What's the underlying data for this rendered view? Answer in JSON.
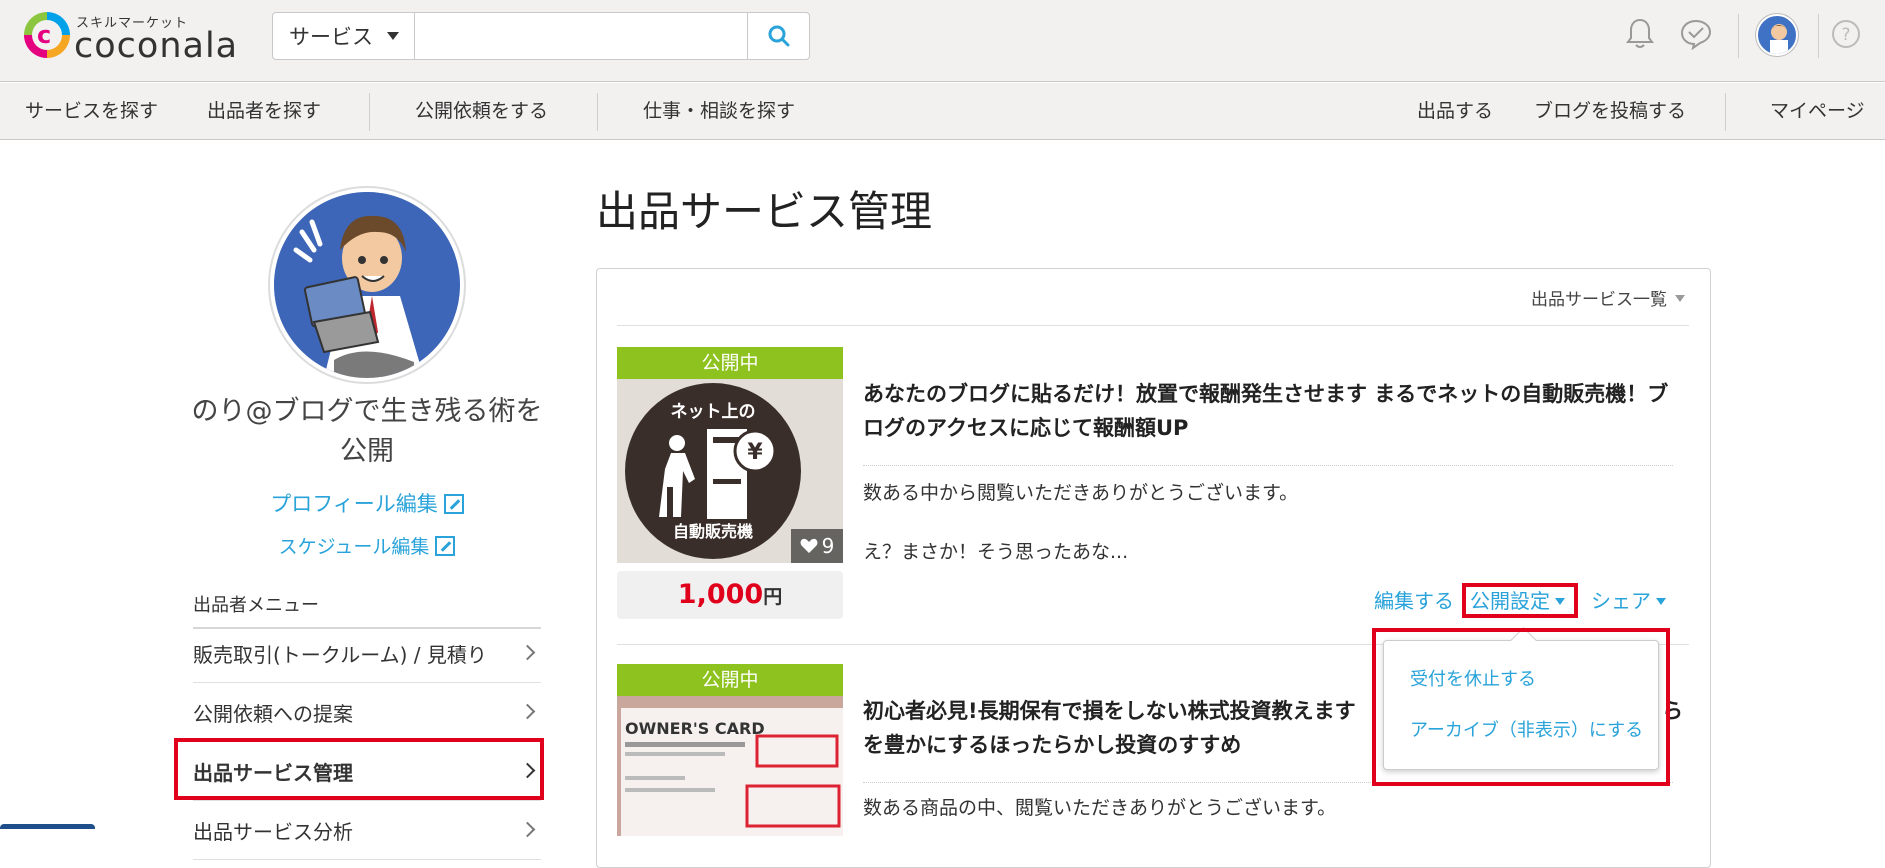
{
  "header": {
    "logo_small": "スキルマーケット",
    "logo_text": "coconala",
    "search": {
      "category": "サービス",
      "placeholder": ""
    }
  },
  "nav": {
    "left": [
      "サービスを探す",
      "出品者を探す",
      "公開依頼をする",
      "仕事・相談を探す"
    ],
    "right": [
      "出品する",
      "ブログを投稿する",
      "マイページ"
    ]
  },
  "sidebar": {
    "user_name": "のり@ブログで生き残る術を公開",
    "profile_edit": "プロフィール編集",
    "schedule_edit": "スケジュール編集",
    "menu_title": "出品者メニュー",
    "menu_items": [
      "販売取引(トークルーム) / 見積り",
      "公開依頼への提案",
      "出品サービス管理",
      "出品サービス分析"
    ]
  },
  "main": {
    "page_title": "出品サービス管理",
    "list_select": "出品サービス一覧",
    "services": [
      {
        "status": "公開中",
        "thumb_text_top": "ネット上の",
        "thumb_text_bottom": "自動販売機",
        "favorites": "9",
        "price": "1,000",
        "price_unit": "円",
        "title": "あなたのブログに貼るだけ！放置で報酬発生させます まるでネットの自動販売機！ブログのアクセスに応じて報酬額UP",
        "desc_line1": "数ある中から閲覧いただきありがとうございます。",
        "desc_line2": "え？まさか！そう思ったあな..."
      },
      {
        "status": "公開中",
        "thumb_text_top": "OWNER'S CARD",
        "title_line1": "初心者必見!長期保有で損をしない株式投資教えます",
        "title_tail": "を豊かにするほったらかし投資のすすめ",
        "title_cut": "ら",
        "desc_line1": "数ある商品の中、閲覧いただきありがとうございます。"
      }
    ],
    "actions": {
      "edit": "編集する",
      "publish": "公開設定",
      "share": "シェア"
    },
    "dropdown": [
      "受付を休止する",
      "アーカイブ（非表示）にする"
    ]
  },
  "colors": {
    "accent": "#29a3d9",
    "status": "#8dc21f",
    "price": "#e0001b",
    "highlight": "#e0001b"
  }
}
